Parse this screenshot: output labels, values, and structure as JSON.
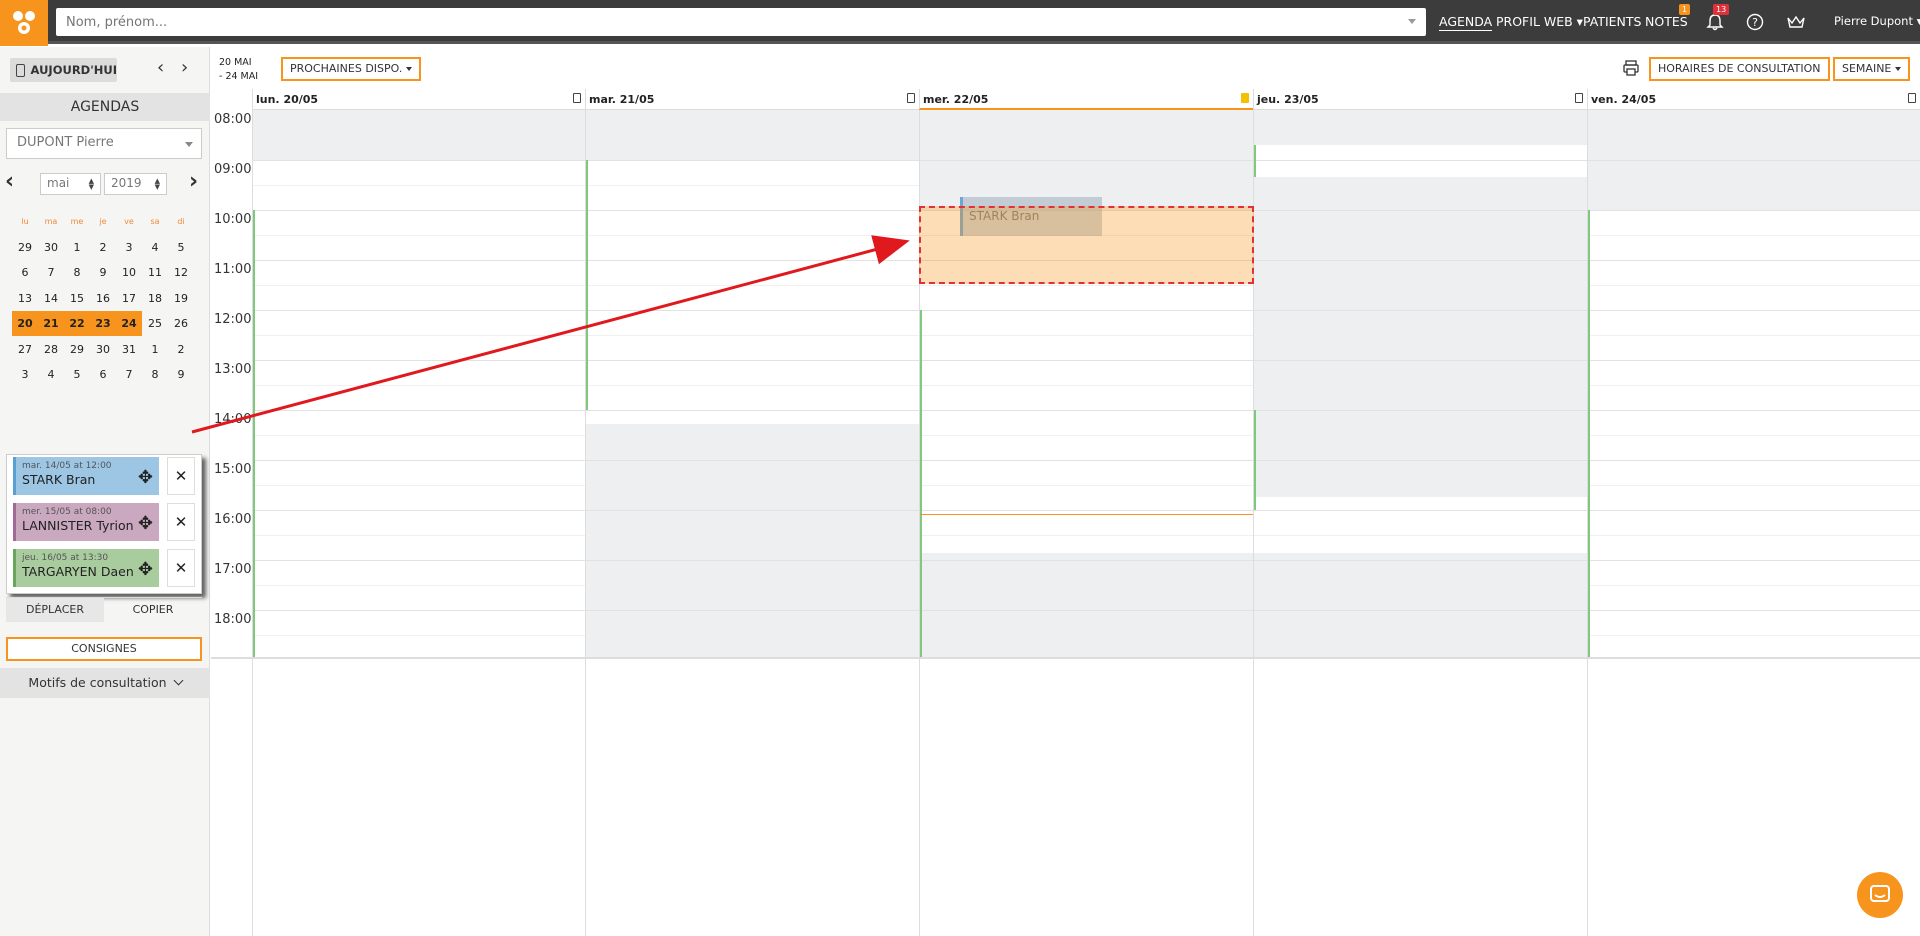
{
  "topbar": {
    "search_placeholder": "Nom, prénom...",
    "nav": [
      "AGENDA",
      "PROFIL WEB ▾",
      "PATIENTS",
      "NOTES"
    ],
    "notes_badge": "1",
    "bell_badge": "13",
    "user": "Pierre Dupont ▾"
  },
  "left": {
    "today_label": "AUJOURD'HUI",
    "agendas_title": "AGENDAS",
    "doctor": "DUPONT Pierre",
    "month": "mai",
    "year": "2019",
    "weekdays": [
      "lu",
      "ma",
      "me",
      "je",
      "ve",
      "sa",
      "di"
    ],
    "weeks": [
      [
        "29",
        "30",
        "1",
        "2",
        "3",
        "4",
        "5"
      ],
      [
        "6",
        "7",
        "8",
        "9",
        "10",
        "11",
        "12"
      ],
      [
        "13",
        "14",
        "15",
        "16",
        "17",
        "18",
        "19"
      ],
      [
        "20",
        "21",
        "22",
        "23",
        "24",
        "25",
        "26"
      ],
      [
        "27",
        "28",
        "29",
        "30",
        "31",
        "1",
        "2"
      ],
      [
        "3",
        "4",
        "5",
        "6",
        "7",
        "8",
        "9"
      ]
    ],
    "moves": [
      {
        "date": "mar. 14/05 at 12:00",
        "name": "STARK Bran",
        "color": "#9cc6e4",
        "border": "#5b9fd1"
      },
      {
        "date": "mer. 15/05 at 08:00",
        "name": "LANNISTER Tyrion",
        "color": "#c9a8c0",
        "border": "#a06a94"
      },
      {
        "date": "jeu. 16/05 at 13:30",
        "name": "TARGARYEN Daen",
        "color": "#a9cc9f",
        "border": "#6aa55d"
      }
    ],
    "move_tab": "DÉPLACER",
    "copy_tab": "COPIER",
    "consignes": "CONSIGNES",
    "motifs": "Motifs de consultation"
  },
  "main": {
    "range_line1": "20 MAI",
    "range_line2": "- 24 MAI",
    "prochaines": "PROCHAINES DISPO.",
    "horaires": "HORAIRES DE CONSULTATION",
    "semaine": "SEMAINE",
    "days": [
      "lun. 20/05",
      "mar. 21/05",
      "mer. 22/05",
      "jeu. 23/05",
      "ven. 24/05"
    ],
    "hours": [
      "08:00",
      "09:00",
      "10:00",
      "11:00",
      "12:00",
      "13:00",
      "14:00",
      "15:00",
      "16:00",
      "17:00",
      "18:00"
    ],
    "ghost_name": "STARK Bran"
  }
}
